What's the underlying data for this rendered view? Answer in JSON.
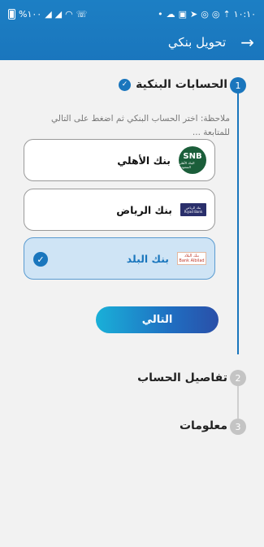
{
  "status_bar": {
    "battery_text": "%١٠٠",
    "time": "١٠:١٠",
    "left_icons": [
      "battery-icon",
      "signal-icon",
      "signal-icon",
      "wifi-icon",
      "wifi-call-icon"
    ],
    "right_icons": [
      "dot-icon",
      "cloud-icon",
      "gallery-icon",
      "telegram-icon",
      "whatsapp-icon",
      "whatsapp-icon",
      "upload-icon"
    ]
  },
  "header": {
    "title": "تحويل بنكي",
    "back_glyph": "→"
  },
  "steps": [
    {
      "number": "1",
      "title": "الحسابات البنكية",
      "state": "active"
    },
    {
      "number": "2",
      "title": "تفاصيل الحساب",
      "state": "inactive"
    },
    {
      "number": "3",
      "title": "معلومات",
      "state": "inactive"
    }
  ],
  "note": "ملاحظة: اختر الحساب البنكي ثم اضغط على التالي للمتابعة ...",
  "banks": [
    {
      "name": "بنك الأهلي",
      "logo_text": "SNB",
      "logo_sub": "البنك الأهلي السعودي",
      "selected": false
    },
    {
      "name": "بنك الرياض",
      "logo_text": "بنك الرياض",
      "logo_sub": "Riyad Bank",
      "selected": false
    },
    {
      "name": "بنك البلد",
      "logo_text": "بنك البلاد",
      "logo_sub": "Bank Albilad",
      "selected": true
    }
  ],
  "next_button": "التالي",
  "colors": {
    "primary": "#1a76bd",
    "selected_bg": "#cfe4f5",
    "inactive_step": "#c4c4c4"
  }
}
